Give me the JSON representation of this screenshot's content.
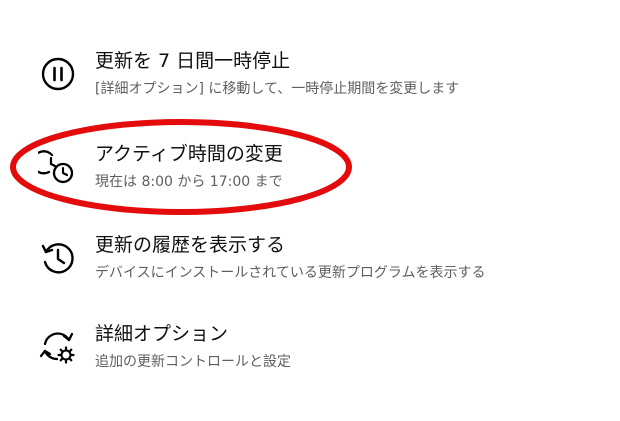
{
  "colors": {
    "highlight": "#e30b0b",
    "title_text": "#111111",
    "subtitle_text": "#5f5f5f"
  },
  "options": [
    {
      "icon": "pause-icon",
      "title": "更新を 7 日間一時停止",
      "subtitle": "[詳細オプション] に移動して、一時停止期間を変更します"
    },
    {
      "icon": "active-hours-clock-icon",
      "title": "アクティブ時間の変更",
      "subtitle": "現在は 8:00 から 17:00 まで"
    },
    {
      "icon": "history-icon",
      "title": "更新の履歴を表示する",
      "subtitle": "デバイスにインストールされている更新プログラムを表示する"
    },
    {
      "icon": "sync-gear-icon",
      "title": "詳細オプション",
      "subtitle": "追加の更新コントロールと設定"
    }
  ]
}
